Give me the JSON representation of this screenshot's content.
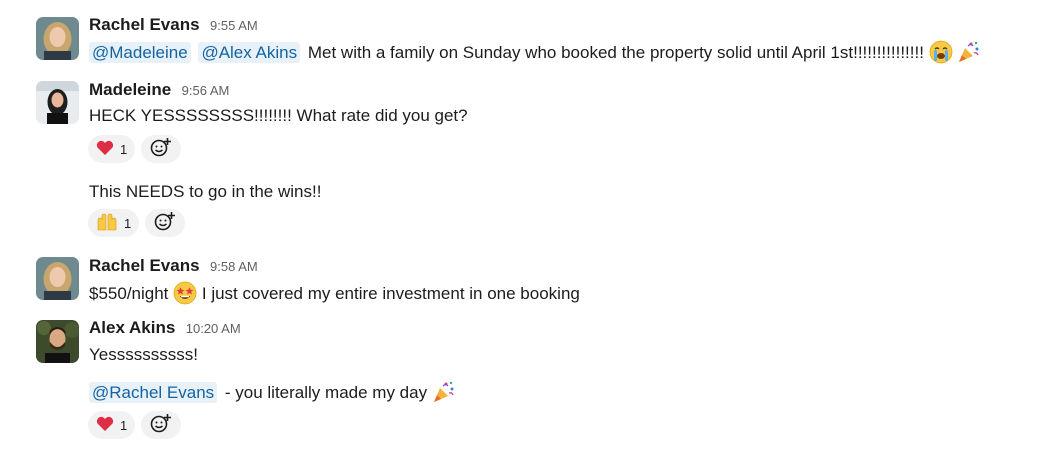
{
  "messages": [
    {
      "author": "Rachel Evans",
      "time": "9:55 AM",
      "mentions": [
        "@Madeleine",
        "@Alex Akins"
      ],
      "text": "Met with a family on Sunday who booked the property solid until April 1st!!!!!!!!!!!!!!!"
    },
    {
      "author": "Madeleine",
      "time": "9:56 AM",
      "text": "HECK YESSSSSSSS!!!!!!!! What rate did you get?",
      "reaction": {
        "emoji": "heart",
        "count": "1"
      },
      "followup_text": "This NEEDS to go in the wins!!",
      "followup_reaction": {
        "emoji": "raised-hands",
        "count": "1"
      }
    },
    {
      "author": "Rachel Evans",
      "time": "9:58 AM",
      "text_before": "$550/night",
      "text_after": "I just covered my entire investment in one booking"
    },
    {
      "author": "Alex Akins",
      "time": "10:20 AM",
      "text": "Yessssssssss!",
      "mention": "@Rachel Evans",
      "followup_text": "- you literally made my day",
      "reaction": {
        "emoji": "heart",
        "count": "1"
      }
    }
  ]
}
